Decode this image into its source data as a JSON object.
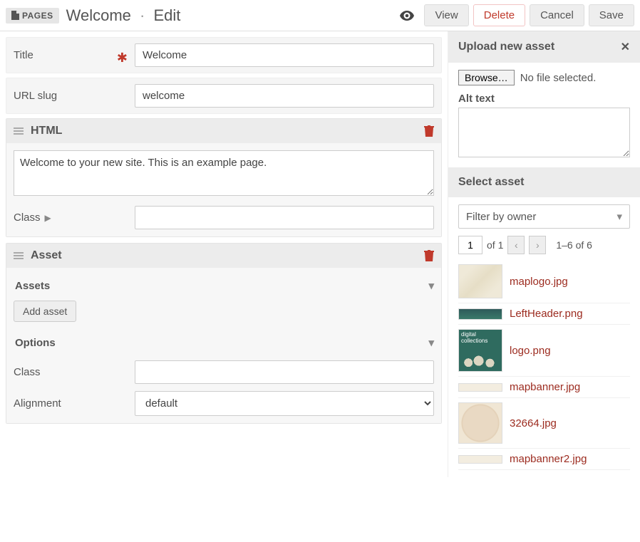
{
  "header": {
    "badge": "PAGES",
    "title_main": "Welcome",
    "title_mode": "Edit",
    "actions": {
      "view": "View",
      "delete": "Delete",
      "cancel": "Cancel",
      "save": "Save"
    }
  },
  "fields": {
    "title_label": "Title",
    "title_value": "Welcome",
    "slug_label": "URL slug",
    "slug_value": "welcome"
  },
  "html_block": {
    "heading": "HTML",
    "content": "Welcome to your new site. This is an example page.",
    "class_label": "Class",
    "class_value": ""
  },
  "asset_block": {
    "heading": "Asset",
    "assets_label": "Assets",
    "add_button": "Add asset",
    "options_label": "Options",
    "class_label": "Class",
    "class_value": "",
    "alignment_label": "Alignment",
    "alignment_value": "default"
  },
  "upload_panel": {
    "heading": "Upload new asset",
    "browse": "Browse…",
    "nofile": "No file selected.",
    "alt_label": "Alt text",
    "alt_value": ""
  },
  "select_panel": {
    "heading": "Select asset",
    "filter_label": "Filter by owner",
    "page_current": "1",
    "page_of": "of 1",
    "range": "1–6 of 6",
    "assets": [
      {
        "name": "maplogo.jpg",
        "thumb": "map"
      },
      {
        "name": "LeftHeader.png",
        "thumb": "left"
      },
      {
        "name": "logo.png",
        "thumb": "logo"
      },
      {
        "name": "mapbanner.jpg",
        "thumb": "banner"
      },
      {
        "name": "32664.jpg",
        "thumb": "globe"
      },
      {
        "name": "mapbanner2.jpg",
        "thumb": "banner"
      }
    ]
  }
}
